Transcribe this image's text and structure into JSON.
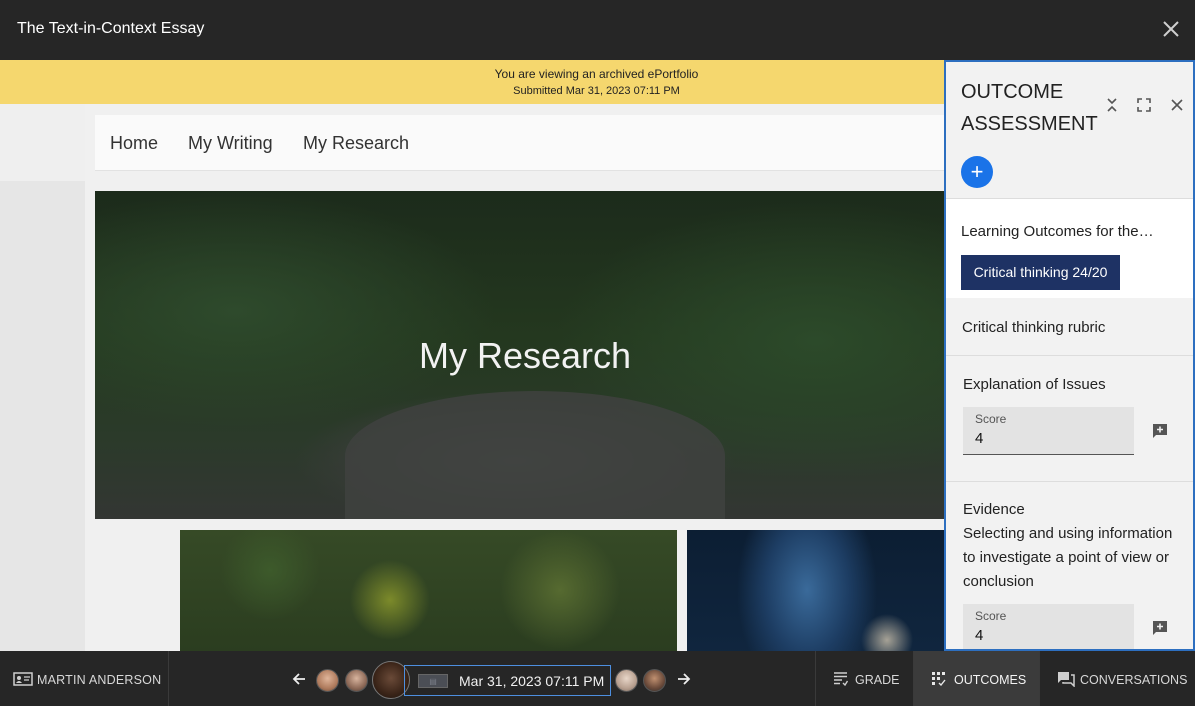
{
  "window": {
    "title": "The Text-in-Context Essay"
  },
  "banner": {
    "line1": "You are viewing an archived ePortfolio",
    "line2": "Submitted Mar 31, 2023 07:11 PM",
    "color": "#f5d76e"
  },
  "portfolio": {
    "nav": [
      "Home",
      "My Writing",
      "My Research"
    ],
    "hero_heading": "My Research"
  },
  "outcome_panel": {
    "title": "OUTCOME ASSESSMENT",
    "add_label": "+",
    "learning_outcomes_title": "Learning Outcomes for the…",
    "chip": "Critical thinking 24/20",
    "rubric_title": "Critical thinking rubric",
    "criteria": [
      {
        "name": "Explanation of Issues",
        "score_label": "Score",
        "score": "4"
      },
      {
        "name": "Evidence",
        "description": "Selecting and using information to investigate a point of view or conclusion",
        "score_label": "Score",
        "score": "4"
      }
    ],
    "accent": "#2d6fc0",
    "chip_color": "#1e3264"
  },
  "bottombar": {
    "student": "MARTIN ANDERSON",
    "date": "Mar 31, 2023 07:11 PM",
    "tabs": [
      {
        "label": "GRADE",
        "icon": "grade-icon"
      },
      {
        "label": "OUTCOMES",
        "icon": "outcomes-icon",
        "active": true
      },
      {
        "label": "CONVERSATIONS",
        "icon": "conversations-icon"
      }
    ]
  }
}
